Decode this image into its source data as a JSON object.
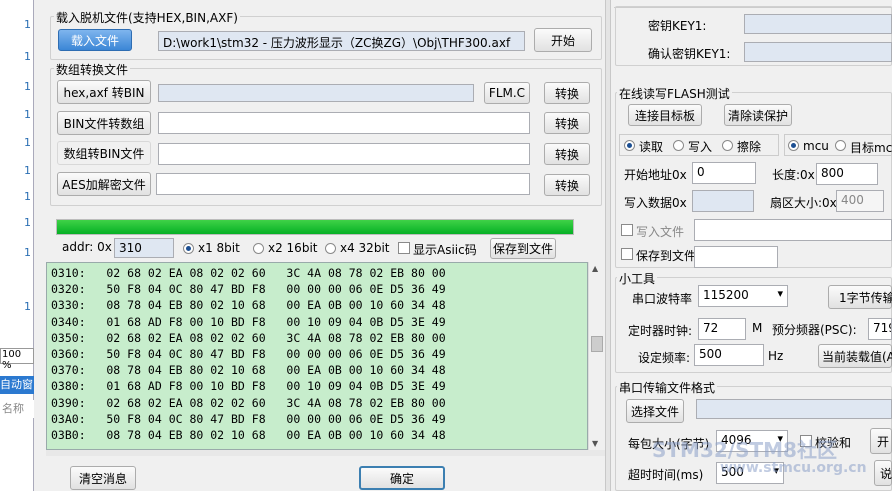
{
  "left_strip": {
    "line_numbers": [
      "1",
      "1",
      "1",
      "1",
      "1",
      "1",
      "1",
      "1",
      "1",
      "1"
    ],
    "zoom": "100 %",
    "auto_window": "自动窗",
    "name_placeholder": "名称"
  },
  "load_group": {
    "title": "载入脱机文件(支持HEX,BIN,AXF)",
    "load_button": "载入文件",
    "file_path": "D:\\work1\\stm32 - 压力波形显示（ZC换ZG）\\Obj\\THF300.axf",
    "start_button": "开始"
  },
  "convert_group": {
    "title": "数组转换文件",
    "rows": [
      {
        "button": "hex,axf 转BIN",
        "value": "",
        "convert": "转换"
      },
      {
        "button": "BIN文件转数组",
        "value": "",
        "convert": "转换"
      },
      {
        "button": "数组转BIN文件",
        "value": "",
        "convert": "转换"
      },
      {
        "button": "AES加解密文件",
        "value": "",
        "convert": "转换"
      }
    ],
    "flm_button": "FLM.C"
  },
  "progress": {
    "percent": 100
  },
  "addr_bar": {
    "addr_label": "addr: 0x",
    "addr_value": "310",
    "opt_8bit": "x1 8bit",
    "opt_16bit": "x2 16bit",
    "opt_32bit": "x4 32bit",
    "show_ascii": "显示Asiic码",
    "save_button": "保存到文件"
  },
  "hex_lines": [
    "0310:   02 68 02 EA 08 02 02 60   3C 4A 08 78 02 EB 80 00",
    "0320:   50 F8 04 0C 80 47 BD F8   00 00 00 06 0E D5 36 49",
    "0330:   08 78 04 EB 80 02 10 68   00 EA 0B 00 10 60 34 48",
    "0340:   01 68 AD F8 00 10 BD F8   00 10 09 04 0B D5 3E 49",
    "0350:   02 68 02 EA 08 02 02 60   3C 4A 08 78 02 EB 80 00",
    "0360:   50 F8 04 0C 80 47 BD F8   00 00 00 06 0E D5 36 49",
    "0370:   08 78 04 EB 80 02 10 68   00 EA 0B 00 10 60 34 48",
    "0380:   01 68 AD F8 00 10 BD F8   00 10 09 04 0B D5 3E 49",
    "0390:   02 68 02 EA 08 02 02 60   3C 4A 08 78 02 EB 80 00",
    "03A0:   50 F8 04 0C 80 47 BD F8   00 00 00 06 0E D5 36 49",
    "03B0:   08 78 04 EB 80 02 10 68   00 EA 0B 00 10 60 34 48"
  ],
  "bottom": {
    "clear_button": "清空消息",
    "ok_button": "确定"
  },
  "right_top": {
    "key_label": "密钥KEY1:",
    "confirm_key_label": "确认密钥KEY1:"
  },
  "flash_group": {
    "title": "在线读写FLASH测试",
    "connect_button": "连接目标板",
    "clear_protect_button": "清除读保护",
    "opt_read": "读取",
    "opt_write": "写入",
    "opt_erase": "擦除",
    "opt_mcu": "mcu",
    "opt_target": "目标mc",
    "start_addr_label": "开始地址0x",
    "start_addr_value": "0",
    "length_label": "长度:0x",
    "length_value": "800",
    "write_data_label": "写入数据0x",
    "sector_label": "扇区大小:0x",
    "sector_value": "400",
    "write_file_label": "写入文件",
    "save_file_label": "保存到文件"
  },
  "tools_group": {
    "title": "小工具",
    "baud_label": "串口波特率",
    "baud_value": "115200",
    "byte_transfer_button": "1字节传输",
    "timer_clock_label": "定时器时钟:",
    "timer_clock_value": "72",
    "timer_clock_unit": "M",
    "prescaler_label": "预分频器(PSC):",
    "prescaler_value": "719",
    "freq_label": "设定频率:",
    "freq_value": "500",
    "freq_unit": "Hz",
    "load_value_button": "当前装载值(A"
  },
  "serial_group": {
    "title": "串口传输文件格式",
    "select_file_button": "选择文件",
    "packet_size_label": "每包大小(字节)",
    "packet_size_value": "4096",
    "checksum_label": "校验和",
    "open_button": "开",
    "timeout_label": "超时时间(ms)",
    "timeout_value": "500",
    "extra_button": "说"
  },
  "watermark": {
    "text1": "STM32/STM8社区",
    "text2": "www.stmcu.org.cn"
  }
}
